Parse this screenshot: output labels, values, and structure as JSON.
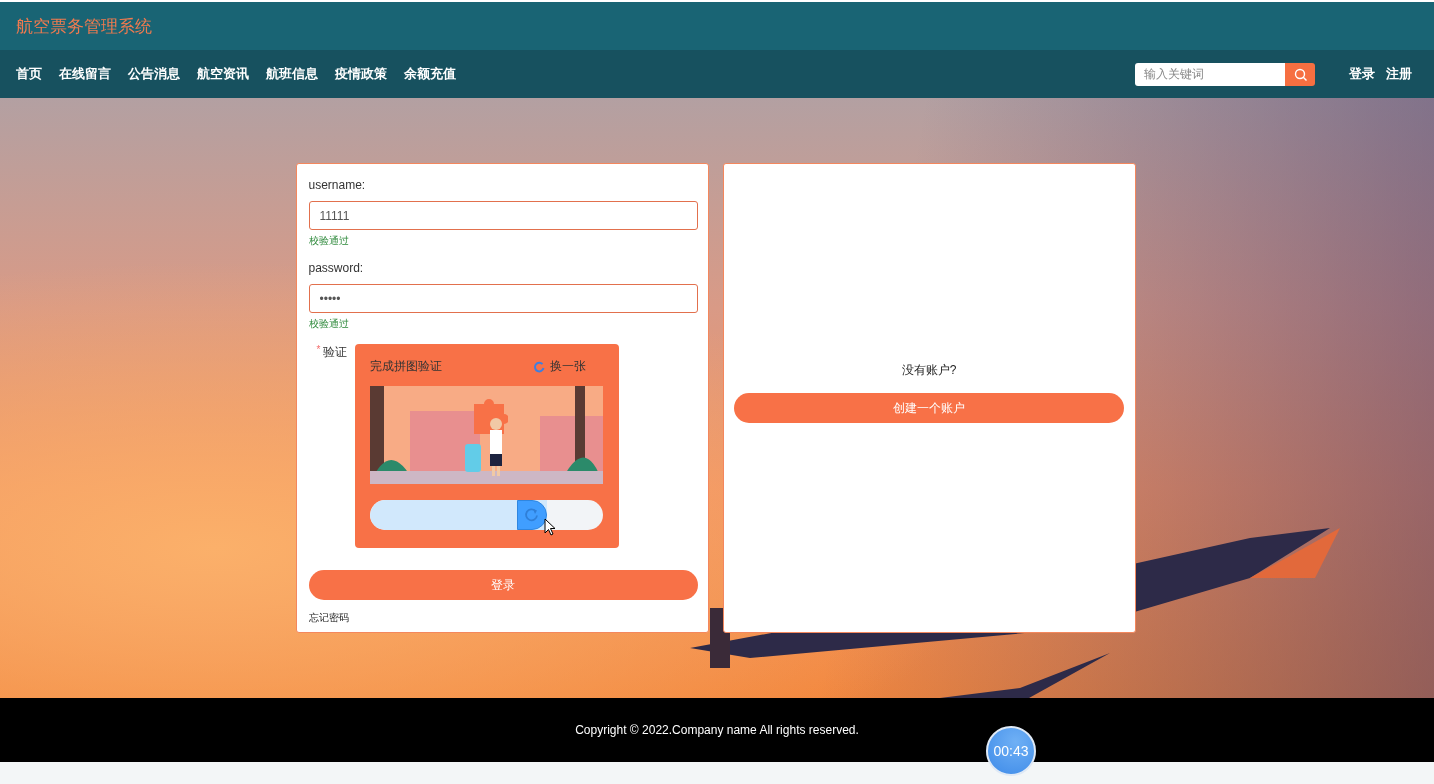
{
  "header": {
    "title": "航空票务管理系统"
  },
  "nav": {
    "items": [
      "首页",
      "在线留言",
      "公告消息",
      "航空资讯",
      "航班信息",
      "疫情政策",
      "余额充值"
    ]
  },
  "search": {
    "placeholder": "输入关键词"
  },
  "auth_links": [
    "登录",
    "注册"
  ],
  "login_form": {
    "fields": [
      {
        "label": "username:",
        "value": "11111",
        "hint": "校验通过"
      },
      {
        "label": "password:",
        "value": "•••••",
        "hint": "校验通过"
      }
    ],
    "captcha": {
      "required_mark": "*",
      "label": "验证",
      "title": "完成拼图验证",
      "refresh": "换一张",
      "level": 0.76
    },
    "submit": "登录",
    "forgot": "忘记密码"
  },
  "register": {
    "prompt": "没有账户?",
    "button": "创建一个账户"
  },
  "footer": {
    "copyright": "Copyright © 2022.Company name All rights reserved."
  },
  "timer": "00:43"
}
